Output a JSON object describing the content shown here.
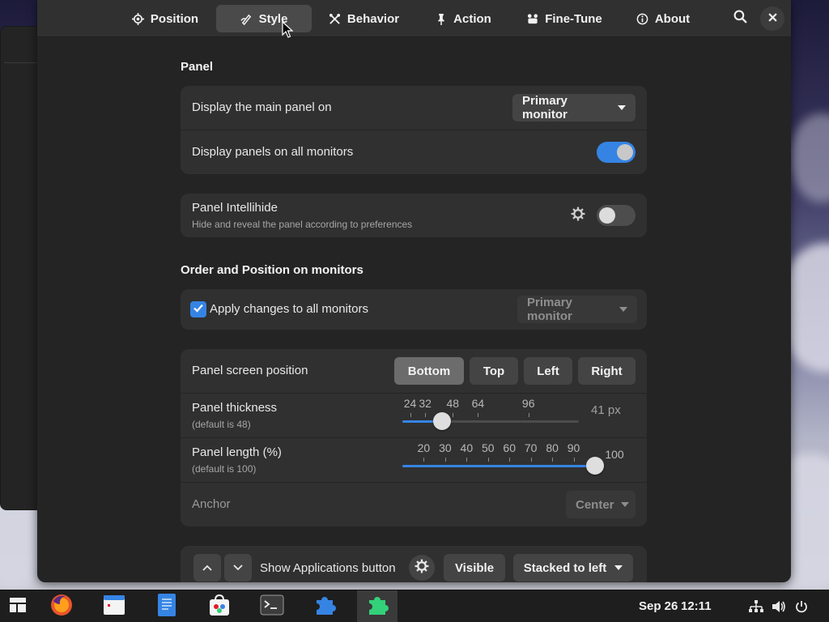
{
  "tabs": [
    {
      "label": "Position",
      "icon": "position-icon"
    },
    {
      "label": "Style",
      "icon": "style-icon"
    },
    {
      "label": "Behavior",
      "icon": "behavior-icon"
    },
    {
      "label": "Action",
      "icon": "action-icon"
    },
    {
      "label": "Fine-Tune",
      "icon": "fine-tune-icon"
    },
    {
      "label": "About",
      "icon": "about-icon"
    }
  ],
  "panel_section": {
    "title": "Panel",
    "main_panel_label": "Display the main panel on",
    "main_panel_value": "Primary monitor",
    "all_monitors_label": "Display panels on all monitors",
    "all_monitors_on": true
  },
  "intellihide": {
    "title": "Panel Intellihide",
    "subtitle": "Hide and reveal the panel according to preferences",
    "enabled": false
  },
  "order_section": {
    "title": "Order and Position on monitors",
    "apply_all_label": "Apply changes to all monitors",
    "apply_all_checked": true,
    "monitor_value": "Primary monitor"
  },
  "screen_position": {
    "label": "Panel screen position",
    "options": [
      "Bottom",
      "Top",
      "Left",
      "Right"
    ],
    "selected": "Bottom"
  },
  "thickness": {
    "label": "Panel thickness",
    "sublabel": "(default is 48)",
    "tick_labels": [
      "24",
      "32",
      "48",
      "64",
      "96"
    ],
    "value_text": "41 px",
    "value": 41
  },
  "length": {
    "label": "Panel length (%)",
    "sublabel": "(default is 100)",
    "tick_labels": [
      "20",
      "30",
      "40",
      "50",
      "60",
      "70",
      "80",
      "90",
      "100"
    ],
    "value": 100
  },
  "anchor": {
    "label": "Anchor",
    "value": "Center"
  },
  "show_apps": {
    "label": "Show Applications button",
    "visibility": "Visible",
    "position": "Stacked to left"
  },
  "taskbar": {
    "apps": [
      "activities-icon",
      "firefox-icon",
      "calendar-icon",
      "text-editor-icon",
      "software-store-icon",
      "terminal-icon",
      "extensions-icon",
      "dash-to-panel-icon"
    ],
    "clock_date": "Sep 26",
    "clock_time": "12:11"
  },
  "colors": {
    "accent": "#3584e4",
    "window_bg": "#242424",
    "card_bg": "#303030"
  }
}
